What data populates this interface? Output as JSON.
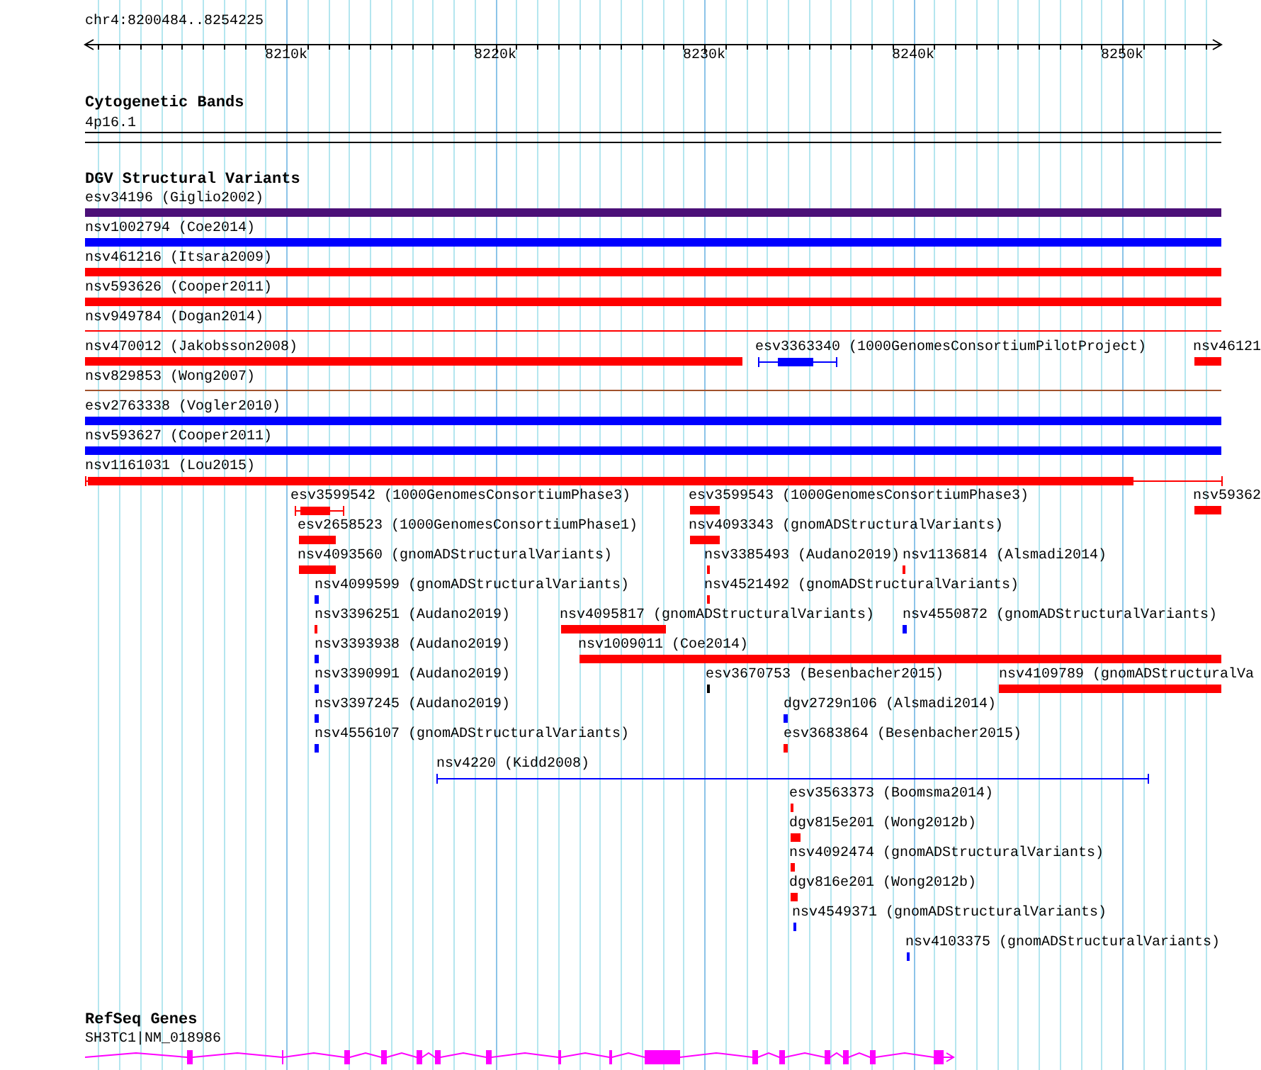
{
  "location": "chr4:8200484..8254225",
  "ruler": {
    "ticks": [
      "8210k",
      "8220k",
      "8230k",
      "8240k",
      "8250k"
    ]
  },
  "cytogenetic_bands": {
    "title": "Cytogenetic Bands",
    "features": [
      {
        "label": "4p16.1"
      }
    ]
  },
  "dgv_structural_variants": {
    "title": "DGV Structural Variants",
    "rows": [
      {
        "features": [
          {
            "label": "esv34196 (Giglio2002)",
            "kind": "bar",
            "color": "#4b1078"
          }
        ]
      },
      {
        "features": [
          {
            "label": "nsv1002794 (Coe2014)",
            "kind": "bar",
            "color": "#0000ff"
          }
        ]
      },
      {
        "features": [
          {
            "label": "nsv461216 (Itsara2009)",
            "kind": "bar",
            "color": "#ff0000"
          }
        ]
      },
      {
        "features": [
          {
            "label": "nsv593626 (Cooper2011)",
            "kind": "bar",
            "color": "#ff0000"
          }
        ]
      },
      {
        "features": [
          {
            "label": "nsv949784 (Dogan2014)",
            "kind": "line",
            "color": "#ff0000"
          }
        ]
      },
      {
        "features": [
          {
            "label": "nsv470012 (Jakobsson2008)",
            "kind": "bar",
            "color": "#ff0000"
          },
          {
            "label": "esv3363340 (1000GenomesConsortiumPilotProject)",
            "kind": "capped",
            "color": "#0000ff"
          },
          {
            "label": "nsv46121",
            "kind": "bar",
            "color": "#ff0000"
          }
        ]
      },
      {
        "features": [
          {
            "label": "nsv829853 (Wong2007)",
            "kind": "line",
            "color": "#a0522d"
          }
        ]
      },
      {
        "features": [
          {
            "label": "esv2763338 (Vogler2010)",
            "kind": "bar",
            "color": "#0000ff"
          }
        ]
      },
      {
        "features": [
          {
            "label": "nsv593627 (Cooper2011)",
            "kind": "bar",
            "color": "#0000ff"
          }
        ]
      },
      {
        "features": [
          {
            "label": "nsv1161031 (Lou2015)",
            "kind": "capped",
            "color": "#ff0000"
          }
        ]
      },
      {
        "features": [
          {
            "label": "esv3599542 (1000GenomesConsortiumPhase3)",
            "kind": "capped",
            "color": "#ff0000"
          },
          {
            "label": "esv3599543 (1000GenomesConsortiumPhase3)",
            "kind": "bar",
            "color": "#ff0000"
          },
          {
            "label": "nsv59362",
            "kind": "bar",
            "color": "#ff0000"
          }
        ]
      },
      {
        "features": [
          {
            "label": "esv2658523 (1000GenomesConsortiumPhase1)",
            "kind": "bar",
            "color": "#ff0000"
          },
          {
            "label": "nsv4093343 (gnomADStructuralVariants)",
            "kind": "bar",
            "color": "#ff0000"
          }
        ]
      },
      {
        "features": [
          {
            "label": "nsv4093560 (gnomADStructuralVariants)",
            "kind": "bar",
            "color": "#ff0000"
          },
          {
            "label": "nsv3385493 (Audano2019)",
            "kind": "bar",
            "color": "#ff0000"
          },
          {
            "label": "nsv1136814 (Alsmadi2014)",
            "kind": "bar",
            "color": "#ff0000"
          }
        ]
      },
      {
        "features": [
          {
            "label": "nsv4099599 (gnomADStructuralVariants)",
            "kind": "bar",
            "color": "#0000ff"
          },
          {
            "label": "nsv4521492 (gnomADStructuralVariants)",
            "kind": "bar",
            "color": "#ff0000"
          }
        ]
      },
      {
        "features": [
          {
            "label": "nsv3396251 (Audano2019)",
            "kind": "bar",
            "color": "#ff0000"
          },
          {
            "label": "nsv4095817 (gnomADStructuralVariants)",
            "kind": "bar",
            "color": "#ff0000"
          },
          {
            "label": "nsv4550872 (gnomADStructuralVariants)",
            "kind": "bar",
            "color": "#0000ff"
          }
        ]
      },
      {
        "features": [
          {
            "label": "nsv3393938 (Audano2019)",
            "kind": "bar",
            "color": "#0000ff"
          },
          {
            "label": "nsv1009011 (Coe2014)",
            "kind": "bar",
            "color": "#ff0000"
          }
        ]
      },
      {
        "features": [
          {
            "label": "nsv3390991 (Audano2019)",
            "kind": "bar",
            "color": "#0000ff"
          },
          {
            "label": "esv3670753 (Besenbacher2015)",
            "kind": "bar",
            "color": "#000000"
          },
          {
            "label": "nsv4109789 (gnomADStructuralVa",
            "kind": "bar",
            "color": "#ff0000"
          }
        ]
      },
      {
        "features": [
          {
            "label": "nsv3397245 (Audano2019)",
            "kind": "bar",
            "color": "#0000ff"
          },
          {
            "label": "dgv2729n106 (Alsmadi2014)",
            "kind": "bar",
            "color": "#0000ff"
          }
        ]
      },
      {
        "features": [
          {
            "label": "nsv4556107 (gnomADStructuralVariants)",
            "kind": "bar",
            "color": "#0000ff"
          },
          {
            "label": "esv3683864 (Besenbacher2015)",
            "kind": "bar",
            "color": "#ff0000"
          }
        ]
      },
      {
        "features": [
          {
            "label": "nsv4220 (Kidd2008)",
            "kind": "capped",
            "color": "#0000ff"
          }
        ]
      },
      {
        "features": [
          {
            "label": "esv3563373 (Boomsma2014)",
            "kind": "bar",
            "color": "#ff0000"
          }
        ]
      },
      {
        "features": [
          {
            "label": "dgv815e201 (Wong2012b)",
            "kind": "bar",
            "color": "#ff0000"
          }
        ]
      },
      {
        "features": [
          {
            "label": "nsv4092474 (gnomADStructuralVariants)",
            "kind": "bar",
            "color": "#ff0000"
          }
        ]
      },
      {
        "features": [
          {
            "label": "dgv816e201 (Wong2012b)",
            "kind": "bar",
            "color": "#ff0000"
          }
        ]
      },
      {
        "features": [
          {
            "label": "nsv4549371 (gnomADStructuralVariants)",
            "kind": "bar",
            "color": "#0000ff"
          }
        ]
      },
      {
        "features": [
          {
            "label": "nsv4103375 (gnomADStructuralVariants)",
            "kind": "bar",
            "color": "#0000ff"
          }
        ]
      }
    ]
  },
  "refseq_genes": {
    "title": "RefSeq Genes",
    "features": [
      {
        "label": "SH3TC1|NM_018986"
      }
    ]
  }
}
